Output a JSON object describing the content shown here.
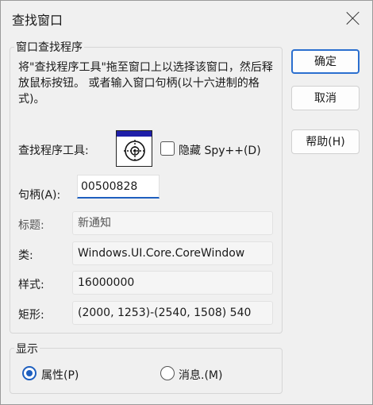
{
  "window": {
    "title": "查找窗口"
  },
  "group_finder": {
    "legend": "窗口查找程序",
    "description": "将\"查找程序工具\"拖至窗口上以选择该窗口，然后释放鼠标按钮。 或者输入窗口句柄(以十六进制的格式)。",
    "finder_tool_label": "查找程序工具:",
    "finder_tool_icon": "crosshair-target-icon",
    "hide_spy_label": "隐藏 Spy++(D)",
    "hide_spy_checked": false,
    "handle_label": "句柄(A):",
    "handle_value": "00500828",
    "caption_label": "标题:",
    "caption_value": "新通知",
    "class_label": "类:",
    "class_value": "Windows.UI.Core.CoreWindow",
    "style_label": "样式:",
    "style_value": "16000000",
    "rect_label": "矩形:",
    "rect_value": "(2000, 1253)-(2540, 1508) 540"
  },
  "buttons": {
    "ok": "确定",
    "cancel": "取消",
    "help": "帮助(H)"
  },
  "group_show": {
    "legend": "显示",
    "properties_label": "属性(P)",
    "messages_label": "消息.(M)",
    "selected": "properties"
  },
  "colors": {
    "accent": "#1e5fbf",
    "finder_bar": "#1f1fa8"
  }
}
